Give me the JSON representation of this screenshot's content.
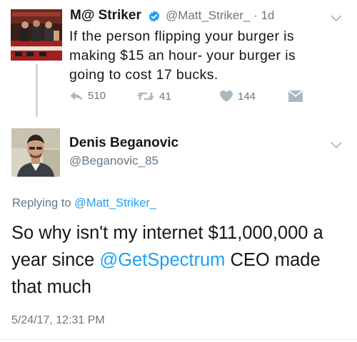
{
  "original_tweet": {
    "display_name": "M@ Striker",
    "handle": "@Matt_Striker_",
    "age": " · 1d",
    "text": "If the person flipping your burger is making $15 an hour- your burger is going to cost 17 bucks.",
    "counts": {
      "replies": "510",
      "retweets": "41",
      "likes": "144"
    }
  },
  "reply_tweet": {
    "display_name": "Denis Beganovic",
    "handle": "@Beganovic_85",
    "replying_prefix": "Replying to ",
    "replying_to": "@Matt_Striker_",
    "text_part1": "So why isn't my internet $11,000,000 a year since ",
    "mention": "@GetSpectrum",
    "text_part2": " CEO made that much",
    "timestamp": "5/24/17, 12:31 PM"
  },
  "icons": {
    "verified": "verified-badge-icon",
    "menu": "chevron-down-icon",
    "reply": "reply-icon",
    "retweet": "retweet-icon",
    "like": "heart-icon",
    "dm": "envelope-icon"
  },
  "colors": {
    "link": "#1da1f2",
    "muted": "#657786",
    "text": "#14171a",
    "thread_line": "#ccd6dd"
  }
}
